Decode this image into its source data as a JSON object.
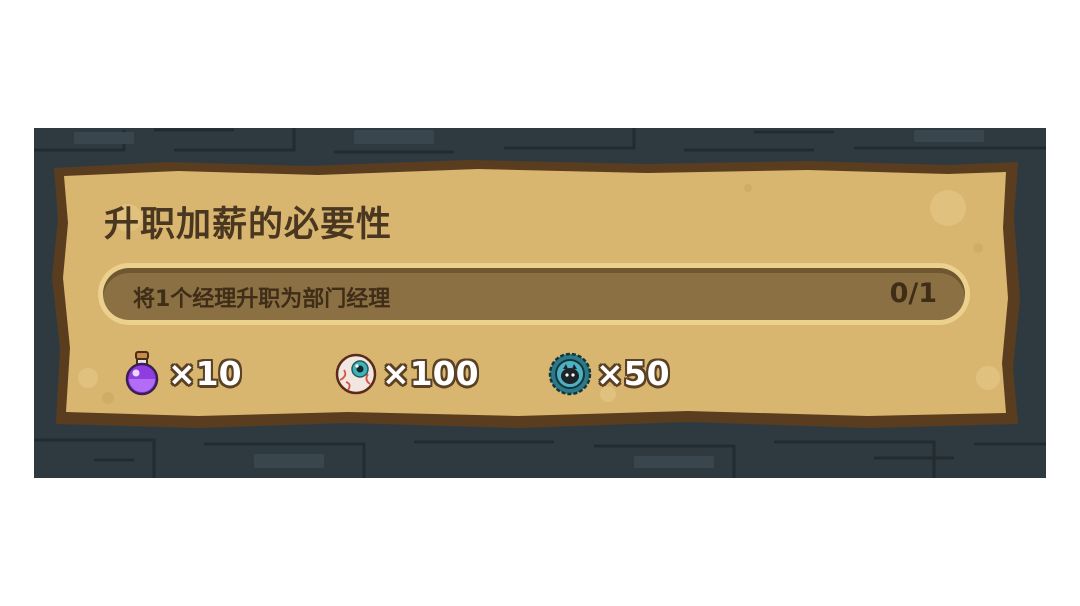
{
  "quest": {
    "title": "升职加薪的必要性",
    "objective": {
      "description": "将1个经理升职为部门经理",
      "count_text": "0/1",
      "progress": 0
    },
    "rewards": [
      {
        "icon": "potion-icon",
        "amount": "×10"
      },
      {
        "icon": "eyeball-icon",
        "amount": "×100"
      },
      {
        "icon": "gear-token-icon",
        "amount": "×50"
      }
    ]
  },
  "colors": {
    "parchment": "#d9b66f",
    "parchment_border": "#5a3d1f",
    "background_stone": "#2f3a40",
    "title_text": "#4a3721",
    "progress_track": "#8a7043",
    "reward_text": "#ffffff"
  }
}
